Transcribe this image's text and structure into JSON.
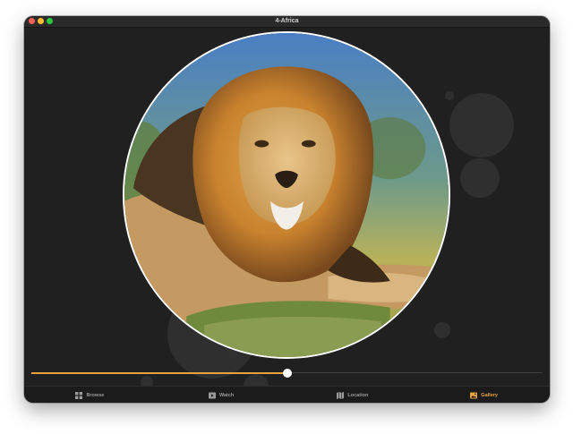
{
  "window": {
    "title": "4-Africa"
  },
  "colors": {
    "accent": "#e8a33a",
    "background": "#202020"
  },
  "playback": {
    "progress_fraction": 0.5
  },
  "tabs": [
    {
      "label": "Browse",
      "icon": "grid-icon",
      "active": false
    },
    {
      "label": "Watch",
      "icon": "play-icon",
      "active": false
    },
    {
      "label": "Location",
      "icon": "map-icon",
      "active": false
    },
    {
      "label": "Gallery",
      "icon": "photo-icon",
      "active": true
    }
  ]
}
